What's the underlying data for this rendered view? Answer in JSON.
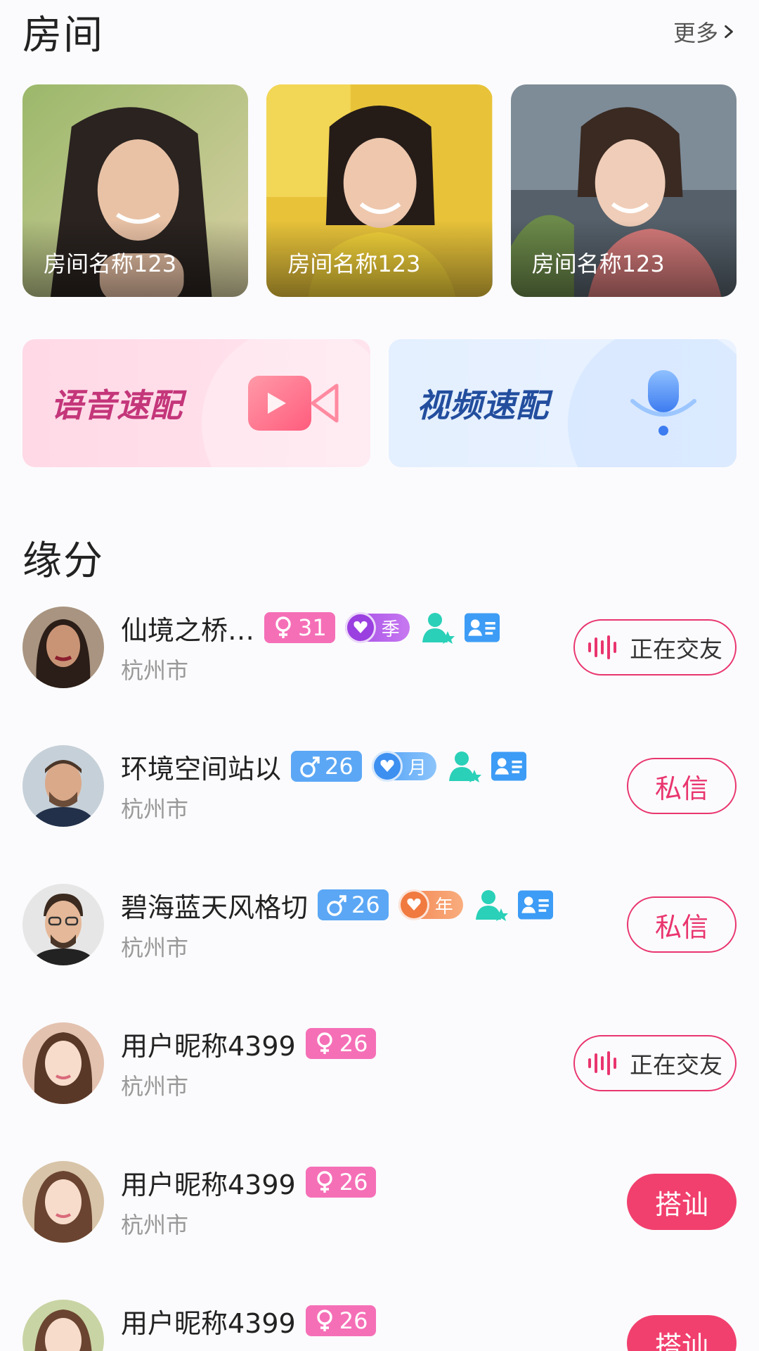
{
  "rooms_section": {
    "title": "房间",
    "more_label": "更多"
  },
  "rooms": [
    {
      "name": "房间名称123"
    },
    {
      "name": "房间名称123"
    },
    {
      "name": "房间名称123"
    }
  ],
  "quick_match": {
    "voice_label": "语音速配",
    "video_label": "视频速配"
  },
  "fate_section": {
    "title": "缘分"
  },
  "users": [
    {
      "name": "仙境之桥…",
      "gender": "female",
      "age": "31",
      "vip_label": "季",
      "vip_type": "season",
      "city": "杭州市",
      "action": "正在交友",
      "action_type": "live"
    },
    {
      "name": "环境空间站以",
      "gender": "male",
      "age": "26",
      "vip_label": "月",
      "vip_type": "month",
      "city": "杭州市",
      "action": "私信",
      "action_type": "msg"
    },
    {
      "name": "碧海蓝天风格切",
      "gender": "male",
      "age": "26",
      "vip_label": "年",
      "vip_type": "year",
      "city": "杭州市",
      "action": "私信",
      "action_type": "msg"
    },
    {
      "name": "用户昵称4399",
      "gender": "female",
      "age": "26",
      "city": "杭州市",
      "action": "正在交友",
      "action_type": "live"
    },
    {
      "name": "用户昵称4399",
      "gender": "female",
      "age": "26",
      "city": "杭州市",
      "action": "搭讪",
      "action_type": "greet"
    },
    {
      "name": "用户昵称4399",
      "gender": "female",
      "age": "26",
      "city": "",
      "action": "搭讪",
      "action_type": "greet"
    }
  ],
  "colors": {
    "accent": "#e9356e",
    "female_badge": "#f56fb7",
    "male_badge": "#5ba7f5"
  }
}
